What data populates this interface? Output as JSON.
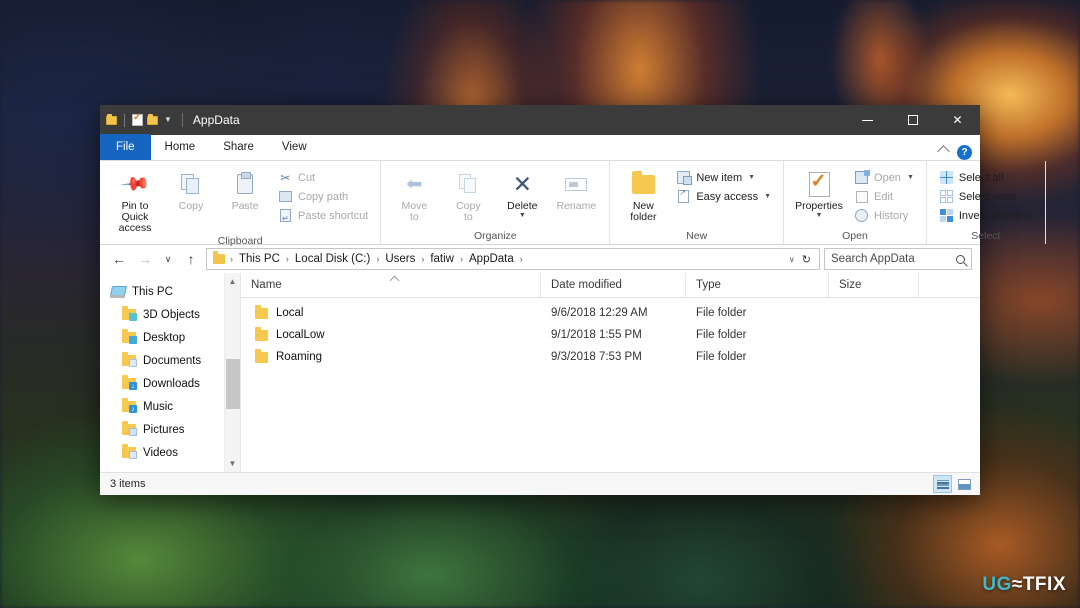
{
  "window": {
    "title": "AppData",
    "quick_access": [
      {
        "name": "folder-icon",
        "label": "Folder"
      },
      {
        "name": "properties-icon",
        "label": "Properties"
      },
      {
        "name": "new-folder-icon",
        "label": "New folder"
      }
    ],
    "controls": {
      "minimize": "–",
      "maximize": "□",
      "close": "✕"
    }
  },
  "tabs": [
    {
      "id": "file",
      "label": "File",
      "active": false,
      "highlight": true
    },
    {
      "id": "home",
      "label": "Home",
      "active": true
    },
    {
      "id": "share",
      "label": "Share",
      "active": false
    },
    {
      "id": "view",
      "label": "View",
      "active": false
    }
  ],
  "tabbar_right": {
    "collapse": "chevron-up-icon",
    "help": "?"
  },
  "ribbon": {
    "groups": [
      {
        "label": "Clipboard",
        "big": [
          {
            "label1": "Pin to Quick",
            "label2": "access",
            "icon": "pin-icon",
            "disabled": false
          },
          {
            "label1": "Copy",
            "label2": "",
            "icon": "copy-icon",
            "disabled": true
          },
          {
            "label1": "Paste",
            "label2": "",
            "icon": "paste-icon",
            "disabled": true
          }
        ],
        "small": [
          {
            "label": "Cut",
            "icon": "scissors-icon",
            "disabled": true
          },
          {
            "label": "Copy path",
            "icon": "copy-path-icon",
            "disabled": true
          },
          {
            "label": "Paste shortcut",
            "icon": "paste-shortcut-icon",
            "disabled": true
          }
        ]
      },
      {
        "label": "Organize",
        "big": [
          {
            "label1": "Move",
            "label2": "to",
            "icon": "move-to-icon",
            "disabled": true,
            "caret": true
          },
          {
            "label1": "Copy",
            "label2": "to",
            "icon": "copy-to-icon",
            "disabled": true,
            "caret": true
          },
          {
            "label1": "Delete",
            "label2": "",
            "icon": "delete-icon",
            "disabled": false,
            "caret": true
          },
          {
            "label1": "Rename",
            "label2": "",
            "icon": "rename-icon",
            "disabled": true
          }
        ],
        "small": []
      },
      {
        "label": "New",
        "big": [
          {
            "label1": "New",
            "label2": "folder",
            "icon": "new-folder-icon",
            "disabled": false
          }
        ],
        "small": [
          {
            "label": "New item",
            "icon": "new-item-icon",
            "disabled": false,
            "caret": true
          },
          {
            "label": "Easy access",
            "icon": "easy-access-icon",
            "disabled": false,
            "caret": true
          }
        ]
      },
      {
        "label": "Open",
        "big": [
          {
            "label1": "Properties",
            "label2": "",
            "icon": "properties-icon",
            "disabled": false,
            "caret": true
          }
        ],
        "small": [
          {
            "label": "Open",
            "icon": "open-icon",
            "disabled": true,
            "caret": true
          },
          {
            "label": "Edit",
            "icon": "edit-icon",
            "disabled": true
          },
          {
            "label": "History",
            "icon": "history-icon",
            "disabled": true
          }
        ]
      },
      {
        "label": "Select",
        "big": [],
        "small": [
          {
            "label": "Select all",
            "icon": "select-all-icon",
            "disabled": false
          },
          {
            "label": "Select none",
            "icon": "select-none-icon",
            "disabled": false
          },
          {
            "label": "Invert selection",
            "icon": "invert-selection-icon",
            "disabled": false
          }
        ]
      }
    ]
  },
  "address": {
    "back": "←",
    "forward": "→",
    "recent": "∨",
    "up": "↑",
    "refresh": "↻",
    "dropdown": "∨",
    "crumbs": [
      "This PC",
      "Local Disk (C:)",
      "Users",
      "fatiw",
      "AppData"
    ],
    "separator": "›"
  },
  "search": {
    "placeholder": "Search AppData",
    "icon": "search-icon"
  },
  "sidebar": {
    "items": [
      {
        "label": "This PC",
        "icon": "this-pc-icon",
        "type": "root"
      },
      {
        "label": "3D Objects",
        "icon": "3d-objects-folder-icon",
        "type": "child",
        "badge": "3d"
      },
      {
        "label": "Desktop",
        "icon": "desktop-folder-icon",
        "type": "child",
        "badge": "desk"
      },
      {
        "label": "Documents",
        "icon": "documents-folder-icon",
        "type": "child",
        "badge": "doc"
      },
      {
        "label": "Downloads",
        "icon": "downloads-folder-icon",
        "type": "child",
        "badge": "down"
      },
      {
        "label": "Music",
        "icon": "music-folder-icon",
        "type": "child",
        "badge": "mus"
      },
      {
        "label": "Pictures",
        "icon": "pictures-folder-icon",
        "type": "child",
        "badge": "pic"
      },
      {
        "label": "Videos",
        "icon": "videos-folder-icon",
        "type": "child",
        "badge": "vid"
      }
    ]
  },
  "filelist": {
    "columns": [
      {
        "key": "name",
        "label": "Name",
        "sorted": "asc"
      },
      {
        "key": "date",
        "label": "Date modified"
      },
      {
        "key": "type",
        "label": "Type"
      },
      {
        "key": "size",
        "label": "Size"
      }
    ],
    "rows": [
      {
        "name": "Local",
        "date": "9/6/2018 12:29 AM",
        "type": "File folder",
        "size": ""
      },
      {
        "name": "LocalLow",
        "date": "9/1/2018 1:55 PM",
        "type": "File folder",
        "size": ""
      },
      {
        "name": "Roaming",
        "date": "9/3/2018 7:53 PM",
        "type": "File folder",
        "size": ""
      }
    ]
  },
  "statusbar": {
    "text": "3 items",
    "views": [
      {
        "name": "details-view-button",
        "active": true
      },
      {
        "name": "large-icons-view-button",
        "active": false
      }
    ]
  },
  "watermark": {
    "prefix": "UG",
    "mid": "≈",
    "suffix": "TFIX",
    "full": "UGETFIX"
  }
}
